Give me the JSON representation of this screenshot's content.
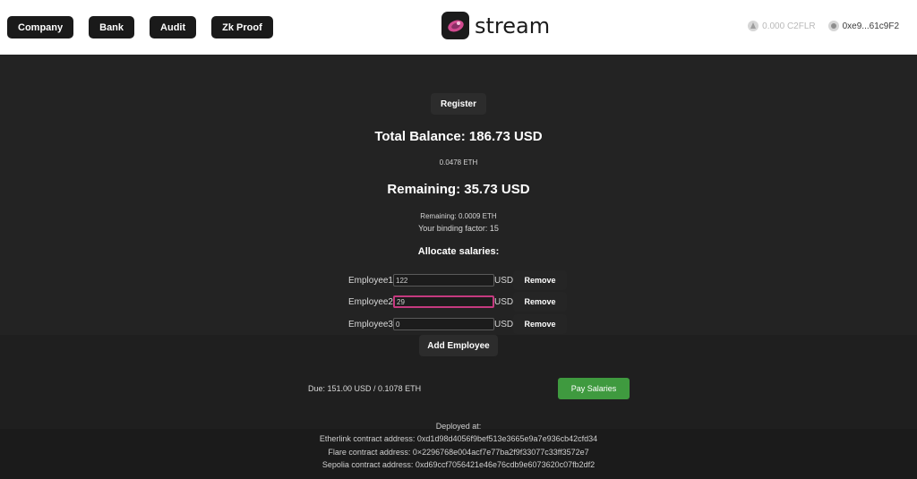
{
  "nav": {
    "items": [
      "Company",
      "Bank",
      "Audit",
      "Zk Proof"
    ]
  },
  "brand": {
    "name": "stream"
  },
  "wallet": {
    "balance": "0.000 C2FLR",
    "address": "0xe9...61c9F2"
  },
  "register_label": "Register",
  "summary": {
    "total_balance": "Total Balance: 186.73 USD",
    "total_eth": "0.0478 ETH",
    "remaining": "Remaining: 35.73 USD",
    "remaining_eth": "Remaining: 0.0009 ETH",
    "binding_factor": "Your binding factor: 15"
  },
  "allocate": {
    "heading": "Allocate salaries:",
    "currency": "USD",
    "remove_label": "Remove",
    "employees": [
      {
        "label": "Employee1",
        "value": "122"
      },
      {
        "label": "Employee2",
        "value": "29"
      },
      {
        "label": "Employee3",
        "value": "0"
      }
    ],
    "add_label": "Add Employee"
  },
  "payment": {
    "due": "Due: 151.00 USD / 0.1078 ETH",
    "pay_label": "Pay Salaries"
  },
  "deployment": {
    "heading": "Deployed at:",
    "etherlink": "Etherlink contract address: 0xd1d98d4056f9bef513e3665e9a7e936cb42cfd34",
    "flare": "Flare contract address: 0×2296768e004acf7e77ba2f9f33077c33ff3572e7",
    "sepolia": "Sepolia contract address: 0xd69ccf7056421e46e76cdb9e6073620c07fb2df2"
  },
  "colors": {
    "accent_pink": "#c43a7f",
    "pay_green": "#3f9a3f",
    "background": "#232323"
  }
}
